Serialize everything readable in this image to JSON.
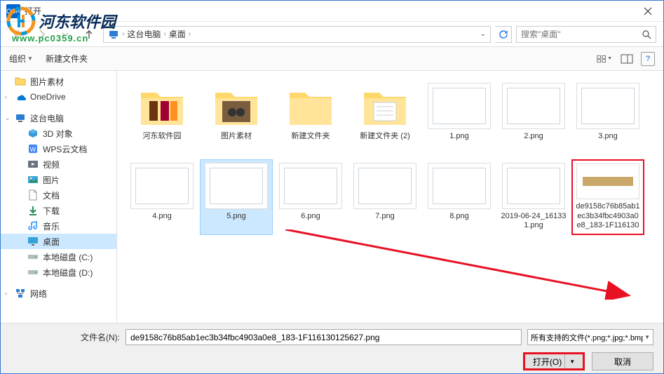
{
  "window": {
    "title": "打开"
  },
  "watermark": {
    "name": "河东软件园",
    "url": "www.pc0359.cn"
  },
  "breadcrumb": {
    "root": "这台电脑",
    "items": [
      "桌面"
    ],
    "sep": "›"
  },
  "search": {
    "placeholder": "搜索\"桌面\""
  },
  "toolbar": {
    "organize": "组织",
    "new_folder": "新建文件夹"
  },
  "sidebar": {
    "items": [
      {
        "label": "图片素材",
        "icon": "folder",
        "level": 1
      },
      {
        "label": "OneDrive",
        "icon": "onedrive",
        "level": 1
      },
      {
        "label": "这台电脑",
        "icon": "pc",
        "level": 1,
        "expanded": true
      },
      {
        "label": "3D 对象",
        "icon": "3d",
        "level": 2
      },
      {
        "label": "WPS云文档",
        "icon": "wps",
        "level": 2
      },
      {
        "label": "视频",
        "icon": "video",
        "level": 2
      },
      {
        "label": "图片",
        "icon": "pictures",
        "level": 2
      },
      {
        "label": "文档",
        "icon": "docs",
        "level": 2
      },
      {
        "label": "下载",
        "icon": "downloads",
        "level": 2
      },
      {
        "label": "音乐",
        "icon": "music",
        "level": 2
      },
      {
        "label": "桌面",
        "icon": "desktop",
        "level": 2,
        "selected": true
      },
      {
        "label": "本地磁盘 (C:)",
        "icon": "disk",
        "level": 2
      },
      {
        "label": "本地磁盘 (D:)",
        "icon": "disk",
        "level": 2
      },
      {
        "label": "网络",
        "icon": "network",
        "level": 1
      }
    ]
  },
  "files": [
    {
      "name": "河东软件园",
      "type": "folder",
      "thumb": "folder-colorful"
    },
    {
      "name": "图片素材",
      "type": "folder",
      "thumb": "folder-cat"
    },
    {
      "name": "新建文件夹",
      "type": "folder",
      "thumb": "folder-empty"
    },
    {
      "name": "新建文件夹 (2)",
      "type": "folder",
      "thumb": "folder-docs"
    },
    {
      "name": "1.png",
      "type": "png",
      "thumb": "screenshot"
    },
    {
      "name": "2.png",
      "type": "png",
      "thumb": "screenshot"
    },
    {
      "name": "3.png",
      "type": "png",
      "thumb": "screenshot"
    },
    {
      "name": "4.png",
      "type": "png",
      "thumb": "screenshot"
    },
    {
      "name": "5.png",
      "type": "png",
      "thumb": "screenshot",
      "selected": true
    },
    {
      "name": "6.png",
      "type": "png",
      "thumb": "screenshot"
    },
    {
      "name": "7.png",
      "type": "png",
      "thumb": "screenshot"
    },
    {
      "name": "8.png",
      "type": "png",
      "thumb": "screenshot"
    },
    {
      "name": "2019-06-24_161331.png",
      "type": "png",
      "thumb": "screenshot"
    },
    {
      "name": "de9158c76b85ab1ec3b34fbc4903a0e8_183-1F116130125627.png",
      "type": "png",
      "thumb": "brown",
      "highlighted": true
    }
  ],
  "bottom": {
    "filename_label": "文件名(N):",
    "filename_value": "de9158c76b85ab1ec3b34fbc4903a0e8_183-1F116130125627.png",
    "filter": "所有支持的文件(*.png;*.jpg;*.bmp;*.gif;*.tif)",
    "open": "打开(O)",
    "cancel": "取消"
  }
}
